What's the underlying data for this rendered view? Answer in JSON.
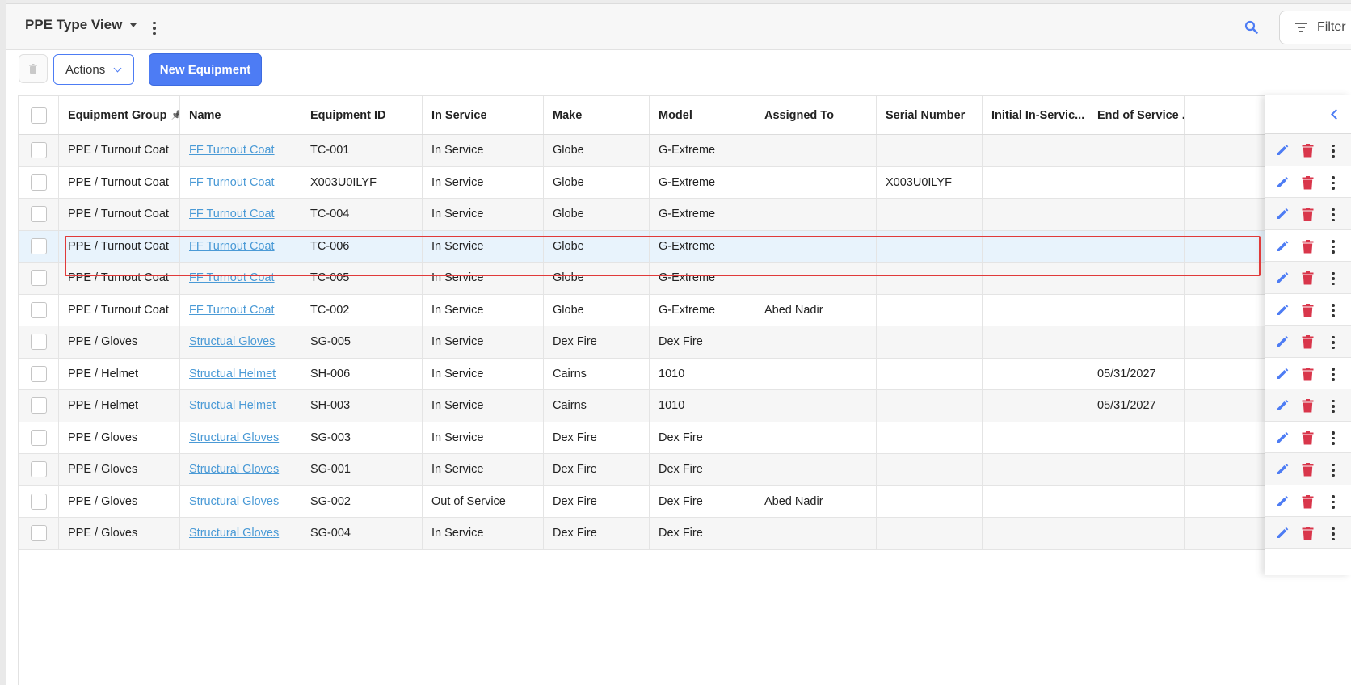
{
  "header": {
    "view_title": "PPE Type View",
    "filter_label": "Filter"
  },
  "toolbar": {
    "actions_label": "Actions",
    "new_label": "New Equipment"
  },
  "colors": {
    "primary": "#4d7cf4",
    "link": "#4a9ad6",
    "delete": "#d9364b",
    "highlight": "#e03a3a",
    "selected_row": "#e8f3fc"
  },
  "table": {
    "columns": [
      "Equipment Group",
      "Name",
      "Equipment ID",
      "In Service",
      "Make",
      "Model",
      "Assigned To",
      "Serial Number",
      "Initial In-Servic...",
      "End of Service ..."
    ],
    "pinned_column_icon": "pin-icon",
    "rows": [
      {
        "group": "PPE / Turnout Coat",
        "name": "FF Turnout Coat",
        "id": "TC-001",
        "status": "In Service",
        "make": "Globe",
        "model": "G-Extreme",
        "assigned": "",
        "serial": "",
        "initial": "",
        "end": ""
      },
      {
        "group": "PPE / Turnout Coat",
        "name": "FF Turnout Coat",
        "id": "X003U0ILYF",
        "status": "In Service",
        "make": "Globe",
        "model": "G-Extreme",
        "assigned": "",
        "serial": "X003U0ILYF",
        "initial": "",
        "end": ""
      },
      {
        "group": "PPE / Turnout Coat",
        "name": "FF Turnout Coat",
        "id": "TC-004",
        "status": "In Service",
        "make": "Globe",
        "model": "G-Extreme",
        "assigned": "",
        "serial": "",
        "initial": "",
        "end": ""
      },
      {
        "group": "PPE / Turnout Coat",
        "name": "FF Turnout Coat",
        "id": "TC-006",
        "status": "In Service",
        "make": "Globe",
        "model": "G-Extreme",
        "assigned": "",
        "serial": "",
        "initial": "",
        "end": "",
        "selected": true
      },
      {
        "group": "PPE / Turnout Coat",
        "name": "FF Turnout Coat",
        "id": "TC-005",
        "status": "In Service",
        "make": "Globe",
        "model": "G-Extreme",
        "assigned": "",
        "serial": "",
        "initial": "",
        "end": ""
      },
      {
        "group": "PPE / Turnout Coat",
        "name": "FF Turnout Coat",
        "id": "TC-002",
        "status": "In Service",
        "make": "Globe",
        "model": "G-Extreme",
        "assigned": "Abed Nadir",
        "serial": "",
        "initial": "",
        "end": ""
      },
      {
        "group": "PPE / Gloves",
        "name": "Structual Gloves",
        "id": "SG-005",
        "status": "In Service",
        "make": "Dex Fire",
        "model": "Dex Fire",
        "assigned": "",
        "serial": "",
        "initial": "",
        "end": ""
      },
      {
        "group": "PPE / Helmet",
        "name": "Structual Helmet",
        "id": "SH-006",
        "status": "In Service",
        "make": "Cairns",
        "model": "1010",
        "assigned": "",
        "serial": "",
        "initial": "",
        "end": "05/31/2027"
      },
      {
        "group": "PPE / Helmet",
        "name": "Structual Helmet",
        "id": "SH-003",
        "status": "In Service",
        "make": "Cairns",
        "model": "1010",
        "assigned": "",
        "serial": "",
        "initial": "",
        "end": "05/31/2027"
      },
      {
        "group": "PPE / Gloves",
        "name": "Structural Gloves",
        "id": "SG-003",
        "status": "In Service",
        "make": "Dex Fire",
        "model": "Dex Fire",
        "assigned": "",
        "serial": "",
        "initial": "",
        "end": ""
      },
      {
        "group": "PPE / Gloves",
        "name": "Structural Gloves",
        "id": "SG-001",
        "status": "In Service",
        "make": "Dex Fire",
        "model": "Dex Fire",
        "assigned": "",
        "serial": "",
        "initial": "",
        "end": ""
      },
      {
        "group": "PPE / Gloves",
        "name": "Structural Gloves",
        "id": "SG-002",
        "status": "Out of Service",
        "make": "Dex Fire",
        "model": "Dex Fire",
        "assigned": "Abed Nadir",
        "serial": "",
        "initial": "",
        "end": ""
      },
      {
        "group": "PPE / Gloves",
        "name": "Structural Gloves",
        "id": "SG-004",
        "status": "In Service",
        "make": "Dex Fire",
        "model": "Dex Fire",
        "assigned": "",
        "serial": "",
        "initial": "",
        "end": ""
      }
    ]
  }
}
